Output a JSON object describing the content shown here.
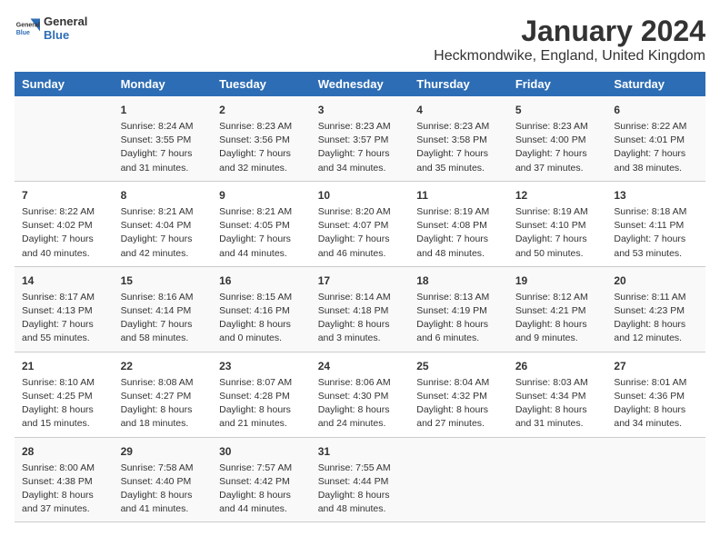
{
  "logo": {
    "line1": "General",
    "line2": "Blue"
  },
  "title": "January 2024",
  "location": "Heckmondwike, England, United Kingdom",
  "days_of_week": [
    "Sunday",
    "Monday",
    "Tuesday",
    "Wednesday",
    "Thursday",
    "Friday",
    "Saturday"
  ],
  "weeks": [
    [
      {
        "day": "",
        "content": ""
      },
      {
        "day": "1",
        "content": "Sunrise: 8:24 AM\nSunset: 3:55 PM\nDaylight: 7 hours\nand 31 minutes."
      },
      {
        "day": "2",
        "content": "Sunrise: 8:23 AM\nSunset: 3:56 PM\nDaylight: 7 hours\nand 32 minutes."
      },
      {
        "day": "3",
        "content": "Sunrise: 8:23 AM\nSunset: 3:57 PM\nDaylight: 7 hours\nand 34 minutes."
      },
      {
        "day": "4",
        "content": "Sunrise: 8:23 AM\nSunset: 3:58 PM\nDaylight: 7 hours\nand 35 minutes."
      },
      {
        "day": "5",
        "content": "Sunrise: 8:23 AM\nSunset: 4:00 PM\nDaylight: 7 hours\nand 37 minutes."
      },
      {
        "day": "6",
        "content": "Sunrise: 8:22 AM\nSunset: 4:01 PM\nDaylight: 7 hours\nand 38 minutes."
      }
    ],
    [
      {
        "day": "7",
        "content": "Sunrise: 8:22 AM\nSunset: 4:02 PM\nDaylight: 7 hours\nand 40 minutes."
      },
      {
        "day": "8",
        "content": "Sunrise: 8:21 AM\nSunset: 4:04 PM\nDaylight: 7 hours\nand 42 minutes."
      },
      {
        "day": "9",
        "content": "Sunrise: 8:21 AM\nSunset: 4:05 PM\nDaylight: 7 hours\nand 44 minutes."
      },
      {
        "day": "10",
        "content": "Sunrise: 8:20 AM\nSunset: 4:07 PM\nDaylight: 7 hours\nand 46 minutes."
      },
      {
        "day": "11",
        "content": "Sunrise: 8:19 AM\nSunset: 4:08 PM\nDaylight: 7 hours\nand 48 minutes."
      },
      {
        "day": "12",
        "content": "Sunrise: 8:19 AM\nSunset: 4:10 PM\nDaylight: 7 hours\nand 50 minutes."
      },
      {
        "day": "13",
        "content": "Sunrise: 8:18 AM\nSunset: 4:11 PM\nDaylight: 7 hours\nand 53 minutes."
      }
    ],
    [
      {
        "day": "14",
        "content": "Sunrise: 8:17 AM\nSunset: 4:13 PM\nDaylight: 7 hours\nand 55 minutes."
      },
      {
        "day": "15",
        "content": "Sunrise: 8:16 AM\nSunset: 4:14 PM\nDaylight: 7 hours\nand 58 minutes."
      },
      {
        "day": "16",
        "content": "Sunrise: 8:15 AM\nSunset: 4:16 PM\nDaylight: 8 hours\nand 0 minutes."
      },
      {
        "day": "17",
        "content": "Sunrise: 8:14 AM\nSunset: 4:18 PM\nDaylight: 8 hours\nand 3 minutes."
      },
      {
        "day": "18",
        "content": "Sunrise: 8:13 AM\nSunset: 4:19 PM\nDaylight: 8 hours\nand 6 minutes."
      },
      {
        "day": "19",
        "content": "Sunrise: 8:12 AM\nSunset: 4:21 PM\nDaylight: 8 hours\nand 9 minutes."
      },
      {
        "day": "20",
        "content": "Sunrise: 8:11 AM\nSunset: 4:23 PM\nDaylight: 8 hours\nand 12 minutes."
      }
    ],
    [
      {
        "day": "21",
        "content": "Sunrise: 8:10 AM\nSunset: 4:25 PM\nDaylight: 8 hours\nand 15 minutes."
      },
      {
        "day": "22",
        "content": "Sunrise: 8:08 AM\nSunset: 4:27 PM\nDaylight: 8 hours\nand 18 minutes."
      },
      {
        "day": "23",
        "content": "Sunrise: 8:07 AM\nSunset: 4:28 PM\nDaylight: 8 hours\nand 21 minutes."
      },
      {
        "day": "24",
        "content": "Sunrise: 8:06 AM\nSunset: 4:30 PM\nDaylight: 8 hours\nand 24 minutes."
      },
      {
        "day": "25",
        "content": "Sunrise: 8:04 AM\nSunset: 4:32 PM\nDaylight: 8 hours\nand 27 minutes."
      },
      {
        "day": "26",
        "content": "Sunrise: 8:03 AM\nSunset: 4:34 PM\nDaylight: 8 hours\nand 31 minutes."
      },
      {
        "day": "27",
        "content": "Sunrise: 8:01 AM\nSunset: 4:36 PM\nDaylight: 8 hours\nand 34 minutes."
      }
    ],
    [
      {
        "day": "28",
        "content": "Sunrise: 8:00 AM\nSunset: 4:38 PM\nDaylight: 8 hours\nand 37 minutes."
      },
      {
        "day": "29",
        "content": "Sunrise: 7:58 AM\nSunset: 4:40 PM\nDaylight: 8 hours\nand 41 minutes."
      },
      {
        "day": "30",
        "content": "Sunrise: 7:57 AM\nSunset: 4:42 PM\nDaylight: 8 hours\nand 44 minutes."
      },
      {
        "day": "31",
        "content": "Sunrise: 7:55 AM\nSunset: 4:44 PM\nDaylight: 8 hours\nand 48 minutes."
      },
      {
        "day": "",
        "content": ""
      },
      {
        "day": "",
        "content": ""
      },
      {
        "day": "",
        "content": ""
      }
    ]
  ]
}
